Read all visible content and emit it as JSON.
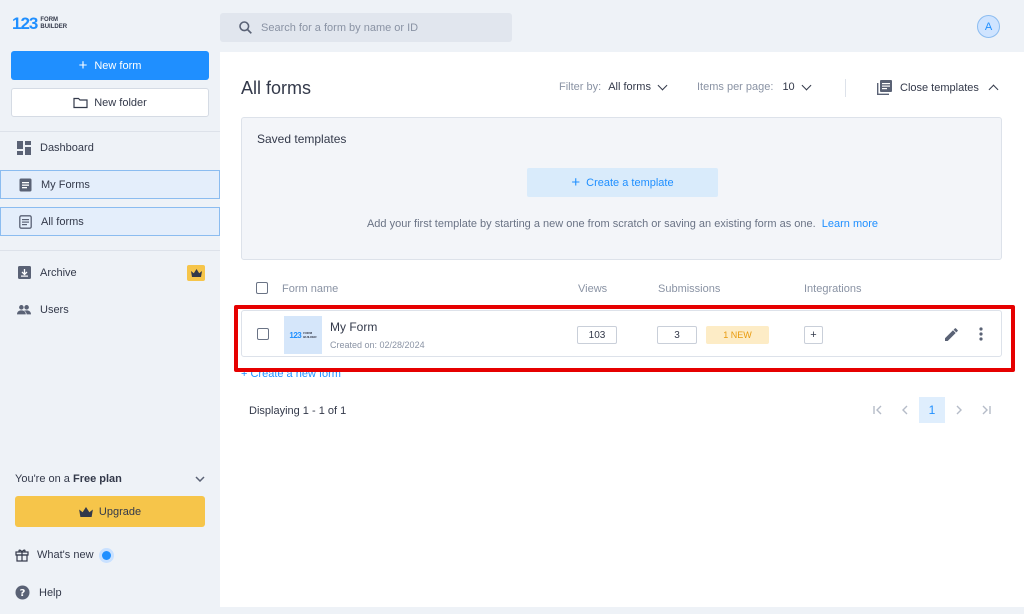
{
  "brand": {
    "logo_number": "123",
    "logo_line1": "FORM",
    "logo_line2": "BUILDER"
  },
  "sidebar": {
    "new_form_label": "New form",
    "new_folder_label": "New folder",
    "items": [
      {
        "label": "Dashboard",
        "icon": "dashboard-icon"
      },
      {
        "label": "My Forms",
        "icon": "form-icon"
      },
      {
        "label": "All forms",
        "icon": "list-icon"
      },
      {
        "label": "Archive",
        "icon": "archive-icon"
      },
      {
        "label": "Users",
        "icon": "users-icon"
      }
    ],
    "plan_prefix": "You're on a",
    "plan_name": "Free plan",
    "upgrade_label": "Upgrade",
    "whats_new_label": "What's new",
    "help_label": "Help"
  },
  "topbar": {
    "search_placeholder": "Search for a form by name or ID",
    "avatar_initial": "A"
  },
  "main": {
    "title": "All forms",
    "filter_label": "Filter by:",
    "filter_value": "All forms",
    "items_per_page_label": "Items per page:",
    "items_per_page_value": "10",
    "close_templates_label": "Close templates",
    "templates": {
      "title": "Saved templates",
      "create_label": "Create a template",
      "hint": "Add your first template by starting a new one from scratch or saving an existing form as one.",
      "learn_more": "Learn more"
    },
    "table": {
      "columns": [
        "Form name",
        "Views",
        "Submissions",
        "Integrations"
      ],
      "rows": [
        {
          "name": "My Form",
          "created": "Created on: 02/28/2024",
          "views": "103",
          "submissions": "3",
          "new_badge": "1 NEW",
          "integrations_add": "+"
        }
      ]
    },
    "create_new_form_link": "+ Create a new form",
    "displaying": "Displaying 1 - 1 of 1",
    "pagination": {
      "current_page": "1"
    }
  },
  "colors": {
    "accent": "#1f8fff",
    "upgrade": "#f6c54a",
    "highlight": "#e60000"
  }
}
